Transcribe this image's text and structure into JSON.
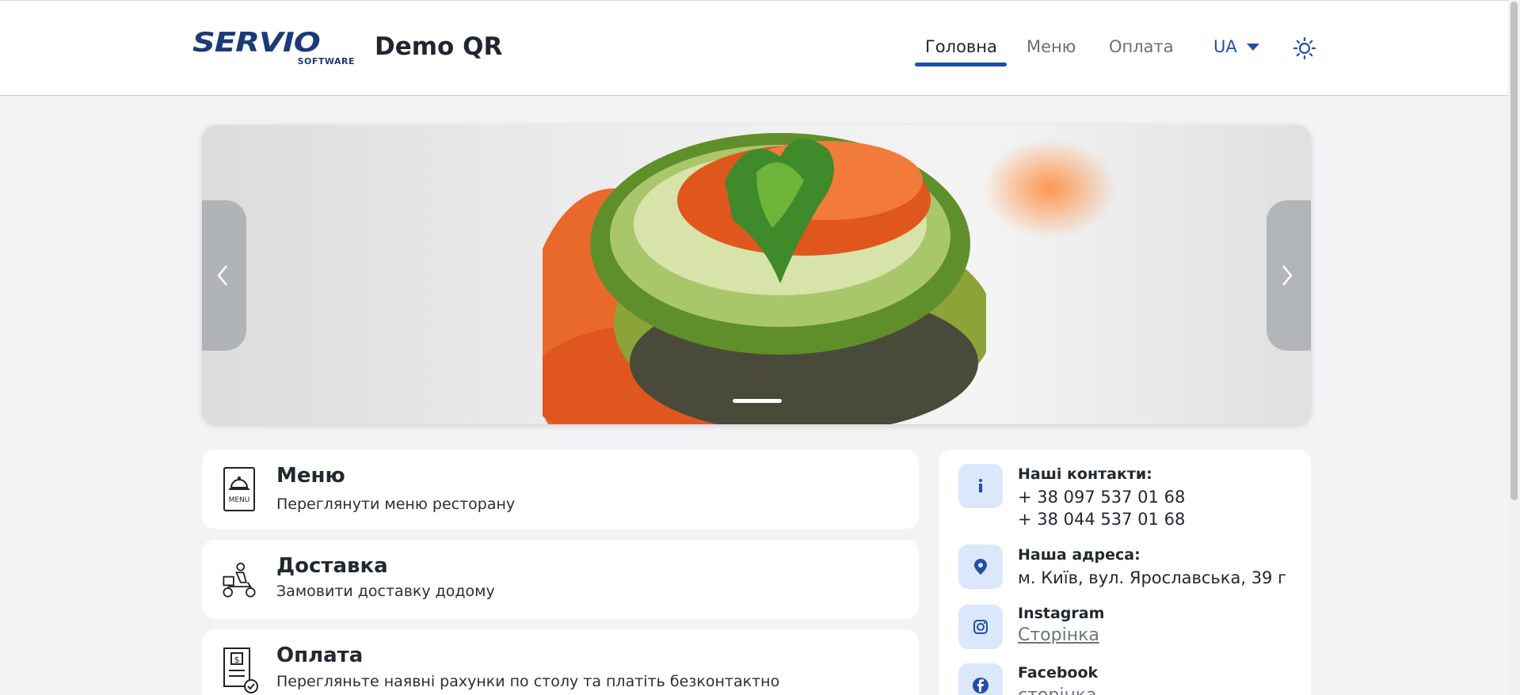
{
  "header": {
    "logo_word": "SERVIO",
    "logo_sub": "SOFTWARE",
    "title": "Demo QR",
    "nav": [
      {
        "label": "Головна",
        "active": true
      },
      {
        "label": "Меню",
        "active": false
      },
      {
        "label": "Оплата",
        "active": false
      }
    ],
    "language": "UA",
    "theme_icon": "sun-icon"
  },
  "carousel": {
    "slides_count": 1,
    "active_slide": 1,
    "prev_icon": "chevron-left-icon",
    "next_icon": "chevron-right-icon"
  },
  "cards": [
    {
      "title": "Меню",
      "subtitle": "Переглянути меню ресторану",
      "icon": "menu-book-icon"
    },
    {
      "title": "Доставка",
      "subtitle": "Замовити доставку додому",
      "icon": "delivery-scooter-icon"
    },
    {
      "title": "Оплата",
      "subtitle": "Перегляньте наявні рахунки по столу та платіть безконтактно",
      "icon": "receipt-icon"
    }
  ],
  "contacts": {
    "phones_label": "Наші контакти:",
    "phones": [
      "+ 38 097 537 01 68",
      "+ 38 044 537 01 68"
    ],
    "address_label": "Наша адреса:",
    "address": "м. Київ, вул. Ярославська, 39 г",
    "instagram_label": "Instagram",
    "instagram_link": "Сторінка",
    "facebook_label": "Facebook",
    "facebook_link": "сторінка"
  },
  "colors": {
    "accent": "#1f4fa8",
    "brand": "#1c3a78",
    "icon_bg": "#dbe8fb",
    "page_bg": "#f3f3f6"
  }
}
